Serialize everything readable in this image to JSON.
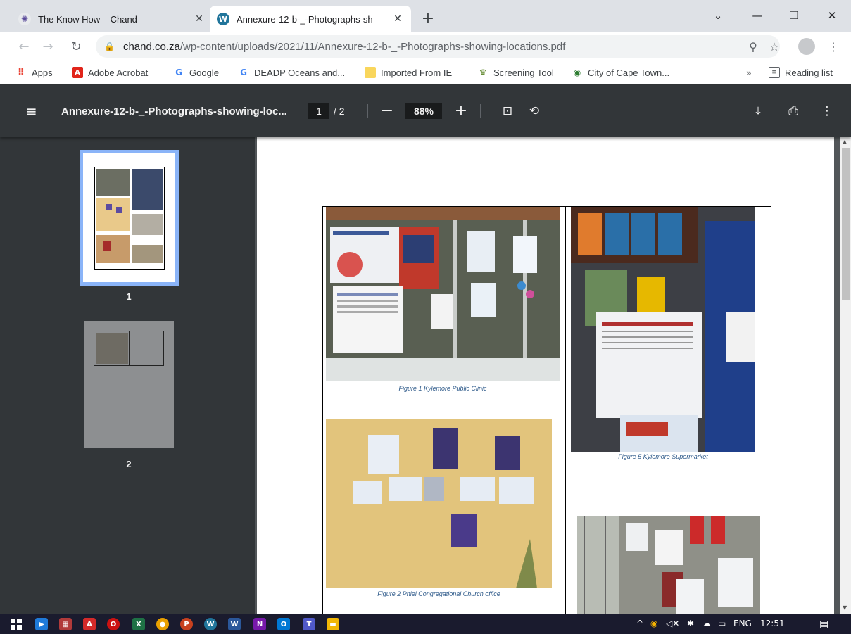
{
  "browser": {
    "tabs": [
      {
        "label": "The Know How – Chand",
        "icon": "know-how-favicon"
      },
      {
        "label": "Annexure-12-b-_-Photographs-sh",
        "icon": "wordpress-favicon"
      }
    ],
    "url_host": "chand.co.za",
    "url_path": "/wp-content/uploads/2021/11/Annexure-12-b-_-Photographs-showing-locations.pdf"
  },
  "bookmarks": [
    {
      "label": "Apps",
      "icon": "apps-grid-icon",
      "color": "#ea4335"
    },
    {
      "label": "Adobe Acrobat",
      "icon": "acrobat-icon",
      "color": "#e1251b"
    },
    {
      "label": "Google",
      "icon": "google-icon",
      "color": "#4285f4"
    },
    {
      "label": "DEADP Oceans and...",
      "icon": "google-icon",
      "color": "#4285f4"
    },
    {
      "label": "Imported From IE",
      "icon": "folder-icon",
      "color": "#f9d65c"
    },
    {
      "label": "Screening Tool",
      "icon": "coat-of-arms-icon",
      "color": "#6a8f3a"
    },
    {
      "label": "City of Cape Town...",
      "icon": "city-icon",
      "color": "#2e7d32"
    }
  ],
  "bookmarks_overflow": "»",
  "reading_list": "Reading list",
  "pdf": {
    "title": "Annexure-12-b-_-Photographs-showing-loc...",
    "page_current": "1",
    "page_total": "/ 2",
    "zoom": "88%",
    "thumbnails": [
      {
        "label": "1"
      },
      {
        "label": "2"
      }
    ]
  },
  "figures": [
    {
      "caption": "Figure 1 Kylemore Public Clinic"
    },
    {
      "caption": "Figure 2 Pniel Congregational Church office"
    },
    {
      "caption": "Figure 5 Kylemore Supermarket"
    }
  ],
  "taskbar": {
    "language": "ENG",
    "time": "12:51"
  },
  "colors": {
    "pdf_toolbar": "#323639",
    "viewer_bg": "#525659",
    "thumb_selected": "#8ab4f8",
    "caption": "#2e5a8a"
  }
}
